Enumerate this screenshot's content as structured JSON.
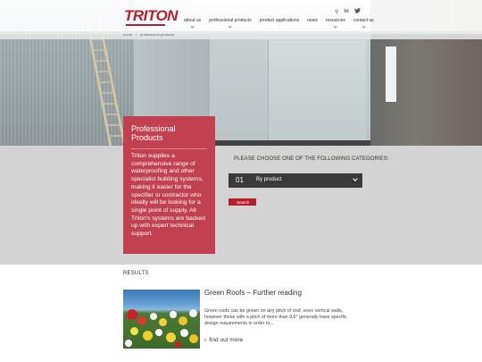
{
  "brand": {
    "logo_text": "TRITON",
    "logo_color": "#b71f2e"
  },
  "header": {
    "nav": [
      {
        "label": "about us"
      },
      {
        "label": "professional products"
      },
      {
        "label": "product applications"
      },
      {
        "label": "news"
      },
      {
        "label": "resources"
      },
      {
        "label": "contact us"
      }
    ],
    "icons": [
      "search-icon",
      "linkedin-icon",
      "twitter-icon"
    ],
    "icon_glyphs": {
      "search": "⚲",
      "linkedin": "in",
      "twitter": "🐦"
    }
  },
  "breadcrumb": {
    "home": "home",
    "separator": "/",
    "current": "professional products"
  },
  "intro": {
    "title": "Professional Products",
    "text": "Triton supplies a comprehensive range of waterproofing and other specialist building systems, making it easier for the specifier or contractor who ideally will be looking for a single point of supply. All Triton's systems are backed up with expert technical support."
  },
  "chooser": {
    "heading": "PLEASE CHOOSE ONE OF THE FOLLOWING CATEGORIES:",
    "select_number": "01",
    "select_value": "By product",
    "search_label": "Search"
  },
  "results": {
    "label": "RESULTS",
    "items": [
      {
        "title": "Green Roofs – Further reading",
        "description": "Green roofs can be grown on any pitch of roof, even vertical walls, however those with a pitch of more than 9.5° generally have specific design requirements in order to...",
        "link": "find out more"
      }
    ]
  },
  "colors": {
    "accent_red": "#b71f2e",
    "panel_red": "#c24151",
    "grey_section": "#d4d3d3",
    "select_bg": "#3a3a3a"
  }
}
